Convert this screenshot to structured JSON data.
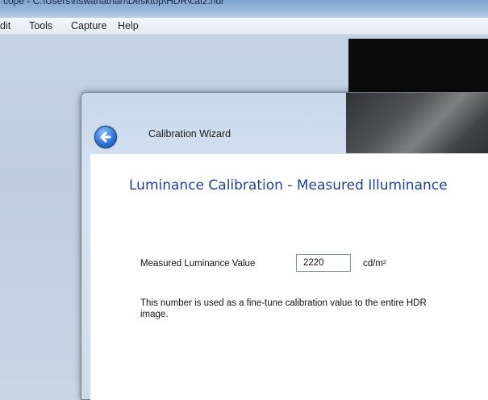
{
  "app": {
    "title_partial": "cope - C:\\Users\\nswanathan\\Desktop\\HDR\\cal2.hdr"
  },
  "menu": [
    "dit",
    "Tools",
    "Capture",
    "Help"
  ],
  "dialog": {
    "title": "Calibration Wizard",
    "heading": "Luminance Calibration - Measured Illuminance",
    "field_label": "Measured Luminance Value",
    "field_value": "2220",
    "unit": "cd/m²",
    "help_text": "This number is used as a fine-tune calibration value to the entire HDR image."
  },
  "icons": {
    "back": "back-arrow-icon"
  },
  "colors": {
    "heading": "#1f3f9a",
    "back_button": "#2a6fd1"
  }
}
